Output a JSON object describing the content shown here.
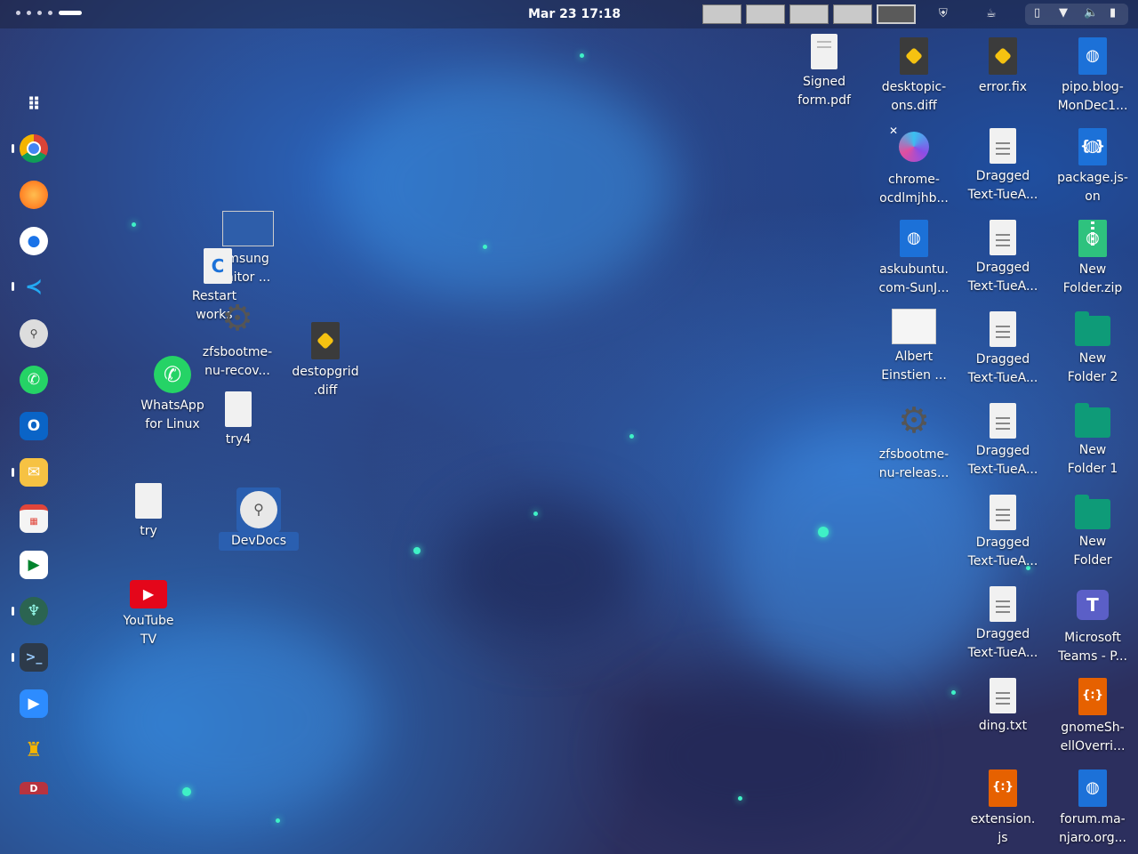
{
  "topbar": {
    "clock": "Mar 23  17:18"
  },
  "dock": {
    "items": [
      {
        "name": "app-grid",
        "icon": "grid-icon"
      },
      {
        "name": "chrome",
        "icon": "chrome-icon"
      },
      {
        "name": "firefox",
        "icon": "firefox-icon"
      },
      {
        "name": "messages",
        "icon": "chat-bubble-icon"
      },
      {
        "name": "vscode",
        "icon": "vscode-icon"
      },
      {
        "name": "search",
        "icon": "magnifier-icon"
      },
      {
        "name": "whatsapp",
        "icon": "whatsapp-icon"
      },
      {
        "name": "outlook",
        "icon": "outlook-icon"
      },
      {
        "name": "mail",
        "icon": "mail-icon"
      },
      {
        "name": "calendar",
        "icon": "calendar-icon"
      },
      {
        "name": "meet",
        "icon": "video-meet-icon"
      },
      {
        "name": "gitkraken",
        "icon": "kraken-icon"
      },
      {
        "name": "terminal",
        "icon": "terminal-icon"
      },
      {
        "name": "zoom",
        "icon": "zoom-icon"
      },
      {
        "name": "kettle",
        "icon": "kettle-icon"
      },
      {
        "name": "app",
        "icon": "app-icon"
      }
    ]
  },
  "desktop": {
    "left": {
      "samsung": "msung\nnitor ...",
      "restart": "Restart\nworks",
      "zfs_recov": "zfsbootme-\nnu-recov...",
      "whatsapp": "WhatsApp\nfor Linux",
      "try4": "try4",
      "destopgrid": "destopgrid\n.diff",
      "try": "try",
      "devdocs": "DevDocs",
      "youtube": "YouTube\nTV"
    },
    "right": {
      "signed": "Signed\nform.pdf",
      "desktopic": "desktopic-\nons.diff",
      "errorfix": "error.fix",
      "pipo": "pipo.blog-\nMonDec1...",
      "chrome_ocd": "chrome-\nocdlmjhb...",
      "dragged1": "Dragged\nText-TueA...",
      "packagejson": "package.js-\non",
      "askubuntu": "askubuntu.\ncom-SunJ...",
      "dragged2": "Dragged\nText-TueA...",
      "newfolderzip": "New\nFolder.zip",
      "einstein": "Albert\nEinstien ...",
      "dragged3": "Dragged\nText-TueA...",
      "newfolder2": "New\nFolder 2",
      "zfs_releas": "zfsbootme-\nnu-releas...",
      "dragged4": "Dragged\nText-TueA...",
      "newfolder1": "New\nFolder 1",
      "dragged5": "Dragged\nText-TueA...",
      "newfolder": "New\nFolder",
      "dragged6": "Dragged\nText-TueA...",
      "teams": "Microsoft\nTeams - P...",
      "dingtxt": "ding.txt",
      "gnomeshell": "gnomeSh-\nellOverri...",
      "extensionjs": "extension.\njs",
      "forum": "forum.ma-\nnjaro.org..."
    }
  }
}
